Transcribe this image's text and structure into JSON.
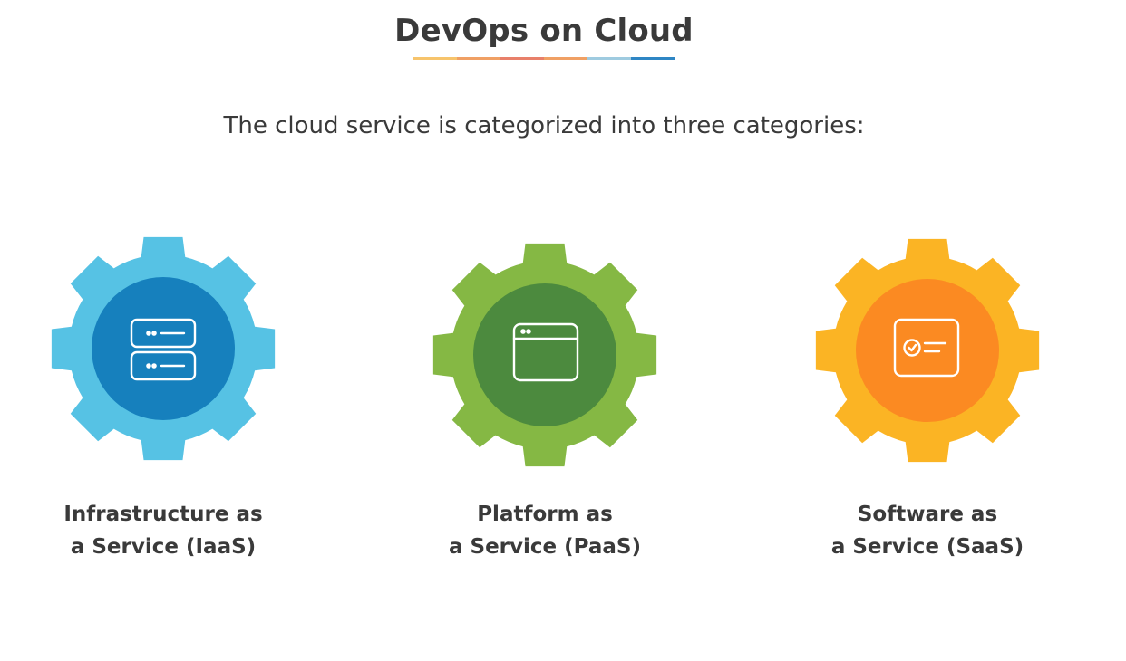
{
  "header": {
    "title": "DevOps on Cloud",
    "subtitle": "The cloud service is categorized into three categories:",
    "underline_colors": [
      "#f7c46c",
      "#f0a064",
      "#e8806a",
      "#f0a064",
      "#9fcbe0",
      "#2f86c4"
    ]
  },
  "services": [
    {
      "line1": "Infrastructure as",
      "line2": "a Service (IaaS)",
      "icon": "server-stack-icon",
      "gear_color": "#56c2e4",
      "inner_color": "#1680bd"
    },
    {
      "line1": "Platform as",
      "line2": "a Service (PaaS)",
      "icon": "browser-window-icon",
      "gear_color": "#85b844",
      "inner_color": "#4c8a3e"
    },
    {
      "line1": "Software as",
      "line2": "a Service (SaaS)",
      "icon": "software-card-icon",
      "gear_color": "#fbb424",
      "inner_color": "#fb8a22"
    }
  ]
}
